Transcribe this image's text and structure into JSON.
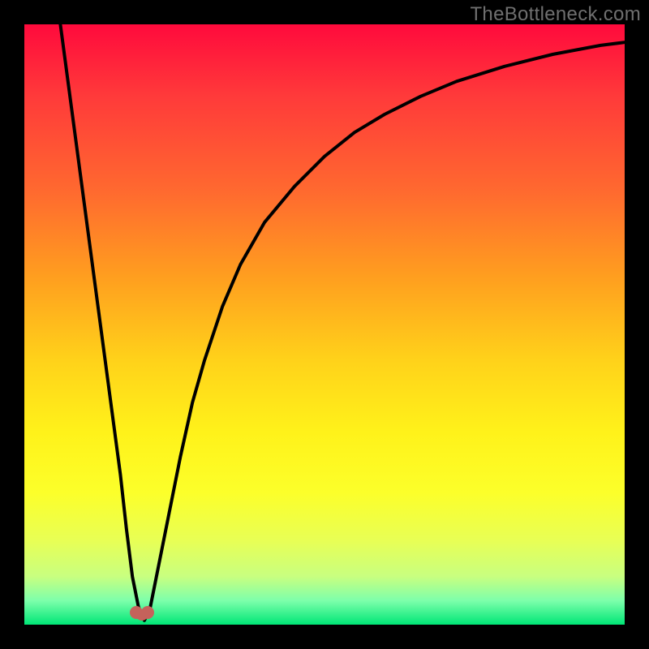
{
  "watermark": "TheBottleneck.com",
  "colors": {
    "frame": "#000000",
    "curve": "#000000",
    "marker": "#c5625b",
    "gradient_top": "#ff0a3c",
    "gradient_bottom": "#00e676"
  },
  "chart_data": {
    "type": "line",
    "title": "",
    "xlabel": "",
    "ylabel": "",
    "xlim": [
      0,
      100
    ],
    "ylim": [
      0,
      100
    ],
    "grid": false,
    "legend": false,
    "axes_visible": false,
    "series": [
      {
        "name": "bottleneck-curve",
        "x": [
          6,
          10,
          12,
          14,
          16,
          17,
          18,
          19,
          20,
          21,
          22,
          24,
          26,
          28,
          30,
          33,
          36,
          40,
          45,
          50,
          55,
          60,
          66,
          72,
          80,
          88,
          96,
          100
        ],
        "y": [
          100,
          70,
          55,
          40,
          25,
          16,
          8,
          3,
          0.7,
          3,
          8,
          18,
          28,
          37,
          44,
          53,
          60,
          67,
          73,
          78,
          82,
          85,
          88,
          90.5,
          93,
          95,
          96.5,
          97
        ]
      }
    ],
    "marker": {
      "x": 19.6,
      "y": 0.9,
      "shape": "u",
      "color": "#c5625b"
    },
    "background_gradient": {
      "direction": "vertical",
      "stops": [
        {
          "pos": 0.0,
          "color": "#ff0a3c"
        },
        {
          "pos": 0.28,
          "color": "#ff6a2f"
        },
        {
          "pos": 0.56,
          "color": "#ffd21a"
        },
        {
          "pos": 0.78,
          "color": "#fcff2a"
        },
        {
          "pos": 0.96,
          "color": "#7dffab"
        },
        {
          "pos": 1.0,
          "color": "#00e676"
        }
      ]
    }
  }
}
